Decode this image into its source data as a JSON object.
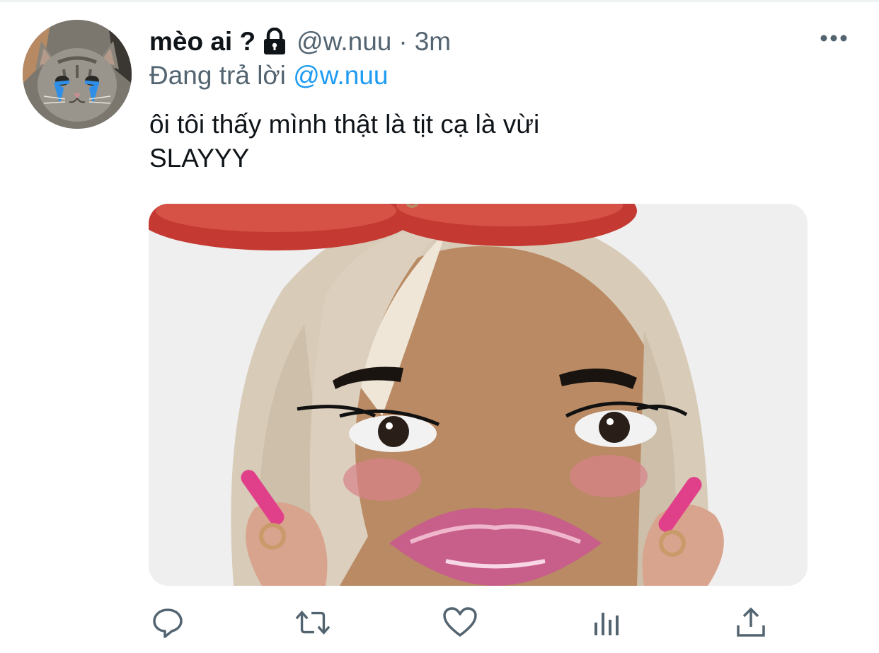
{
  "tweet": {
    "display_name": "mèo ai ?",
    "handle": "@w.nuu",
    "separator": "·",
    "time": "3m",
    "replying_prefix": "Đang trả lời",
    "replying_to": "@w.nuu",
    "text_lines": [
      "ôi tôi thấy mình thật là tịt cạ là vừi",
      "SLAYYY"
    ]
  },
  "icons": {
    "lock": "lock-icon",
    "more": "more-horizontal-icon",
    "reply": "reply-icon",
    "retweet": "retweet-icon",
    "like": "heart-icon",
    "analytics": "analytics-icon",
    "share": "share-icon"
  },
  "colors": {
    "text": "#0f1419",
    "secondary": "#536471",
    "link": "#1d9bf0"
  }
}
